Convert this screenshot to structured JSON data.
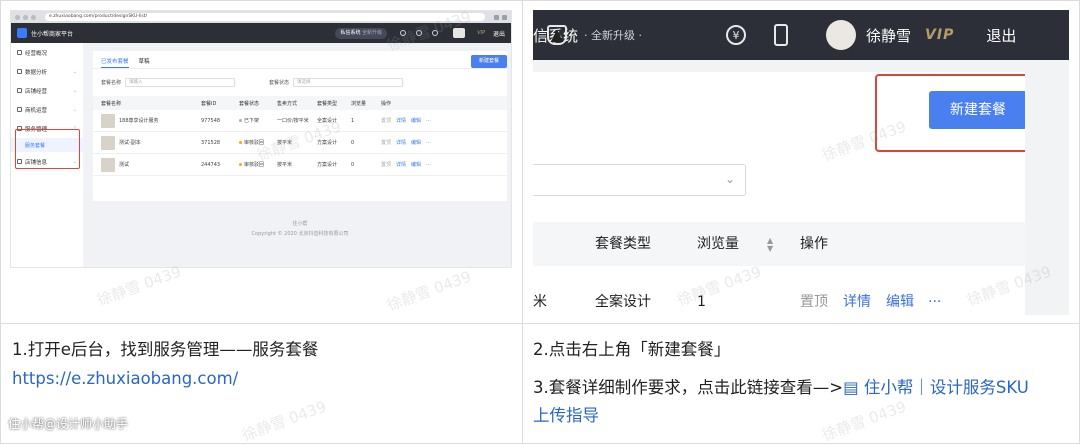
{
  "left_shot": {
    "url": "e.zhuxiaobang.com/product/designSKU-list/",
    "app_name": "住小帮商家平台",
    "system_pill": "私信系统",
    "system_pill_tag": "全新升级",
    "vip": "VIP",
    "exit": "退出",
    "sidebar": [
      {
        "label": "经营概况"
      },
      {
        "label": "数据分析"
      },
      {
        "label": "店铺经营"
      },
      {
        "label": "商机运营"
      },
      {
        "label": "服务管理"
      },
      {
        "label": "店铺信息"
      }
    ],
    "sidebar_sub": "服务套餐",
    "tabs": [
      "已发布套餐",
      "草稿"
    ],
    "new_button": "新建套餐",
    "filter1_label": "套餐名称",
    "filter1_placeholder": "请输入",
    "filter2_label": "套餐状态",
    "filter2_placeholder": "请选择",
    "columns": [
      "套餐名称",
      "套餐ID",
      "套餐状态",
      "售卖方式",
      "套餐类型",
      "浏览量",
      "操作"
    ],
    "rows": [
      {
        "name": "188尊享设计服务",
        "id": "977548",
        "status": "已下架",
        "sale": "一口价/按平米",
        "type": "全案设计",
        "views": "1"
      },
      {
        "name": "测试-副本",
        "id": "371528",
        "status": "审核驳回",
        "sale": "按平米",
        "type": "方案设计",
        "views": "0"
      },
      {
        "name": "测试",
        "id": "244743",
        "status": "审核驳回",
        "sale": "按平米",
        "type": "方案设计",
        "views": "0"
      }
    ],
    "row_actions": [
      "置顶",
      "详情",
      "编辑",
      "···"
    ],
    "footer_line1": "住小帮",
    "footer_line2": "Copyright © 2020 北京抖音科技有限公司",
    "status_colors": {
      "offline": "#b0b0b0",
      "rejected": "#f5a623"
    }
  },
  "right_shot": {
    "system_text": "信系统",
    "upgrade_tag": "· 全新升级 ·",
    "user_name": "徐静雪",
    "vip": "VIP",
    "exit": "退出",
    "new_button": "新建套餐",
    "columns": {
      "type": "套餐类型",
      "views": "浏览量",
      "action": "操作"
    },
    "row": {
      "name_tail": "米",
      "type": "全案设计",
      "views": "1",
      "top": "置顶",
      "detail": "详情",
      "edit": "编辑",
      "more": "···"
    }
  },
  "captions": {
    "step1": "1.打开e后台，找到服务管理——服务套餐",
    "step1_link": "https://e.zhuxiaobang.com/",
    "step2": "2.点击右上角「新建套餐」",
    "step3_prefix": "3.套餐详细制作要求，点击此链接查看—>",
    "step3_link_line1": "住小帮｜设计服务SKU",
    "step3_link_line2": "上传指导"
  },
  "watermark": "徐静雪 0439",
  "source_watermark": "住小帮@设计师小助手",
  "colors": {
    "accent": "#4a7ff0",
    "highlight_box": "#d8453b",
    "topbar": "#2c2f37",
    "link": "#2a66c8"
  }
}
